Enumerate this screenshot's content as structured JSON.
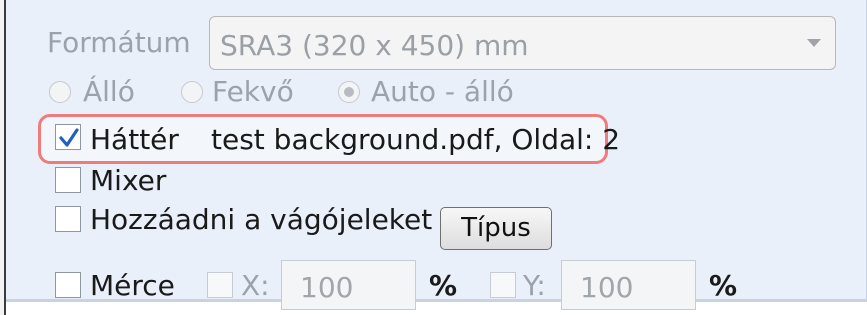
{
  "page": {
    "format_label": "Formátum",
    "format_value": "SRA3 (320 x 450) mm",
    "orientation": {
      "portrait_label": "Álló",
      "landscape_label": "Fekvő",
      "auto_label": "Auto - álló",
      "selected": "auto"
    },
    "background": {
      "label": "Háttér",
      "checked": true,
      "info": "test background.pdf, Oldal: 2"
    },
    "mixer": {
      "label": "Mixer",
      "checked": false
    },
    "crop_marks": {
      "label": "Hozzáadni a vágójeleket",
      "checked": false,
      "type_button_label": "Típus"
    },
    "scale": {
      "label": "Mérce",
      "checked": false,
      "x_label": "X:",
      "x_value": "100",
      "x_unit": "%",
      "y_label": "Y:",
      "y_value": "100",
      "y_unit": "%"
    }
  },
  "colors": {
    "panel_bg": "#e9f0fa",
    "highlight_border": "#ef7c7c",
    "check_color": "#1f5fbf"
  }
}
